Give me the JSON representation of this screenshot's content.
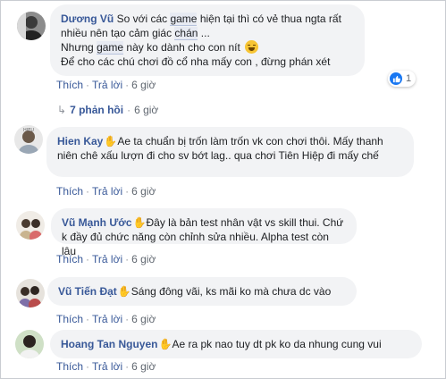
{
  "actions": {
    "like": "Thích",
    "reply": "Trả lời",
    "dot": "·"
  },
  "comments": [
    {
      "name": "Dương Vũ",
      "text_parts": [
        "So với các ",
        "game",
        " hiện tại thì có vẻ thua ngta rất nhiều nên tạo cảm giác ",
        "chán",
        " ...",
        "Nhưng ",
        "game",
        " này ko dành cho con nít ",
        "Để cho các chú chơi đồ cổ nha mấy con , đừng phán xét"
      ],
      "time": "6 giờ",
      "reaction_count": "1",
      "replies": "7 phản hồi",
      "replies_time": "6 giờ"
    },
    {
      "name": "Hien Kay",
      "text": "Ae ta chuẩn bị trốn làm trốn vk con chơi thôi. Mấy thanh niên chê xấu lượn đi cho sv bớt lag.. qua chơi Tiên Hiệp đi mấy chế",
      "time": "6 giờ"
    },
    {
      "name": "Vũ Mạnh Ước",
      "text": "Đây là bản test nhân vật vs skill thui. Chứ k đầy đủ chức năng còn chỉnh sửa nhiều. Alpha test còn lâu",
      "time": "6 giờ"
    },
    {
      "name": "Vũ Tiến Đạt",
      "text": "Sáng đông vãi, ks mãi ko mà chưa dc vào",
      "time": "6 giờ"
    },
    {
      "name": "Hoang Tan Nguyen",
      "text": "Ae ra pk nao tuy dt pk ko da nhung cung vui",
      "time": "6 giờ"
    }
  ],
  "icons": {
    "hand": "waving-hand-icon",
    "emoji": "laughing-emoji-icon",
    "like": "like-icon",
    "reply_arrow": "reply-arrow-icon"
  },
  "colors": {
    "name": "#385898",
    "bubble": "#f2f3f5",
    "like": "#1877f2",
    "meta": "#606770"
  }
}
